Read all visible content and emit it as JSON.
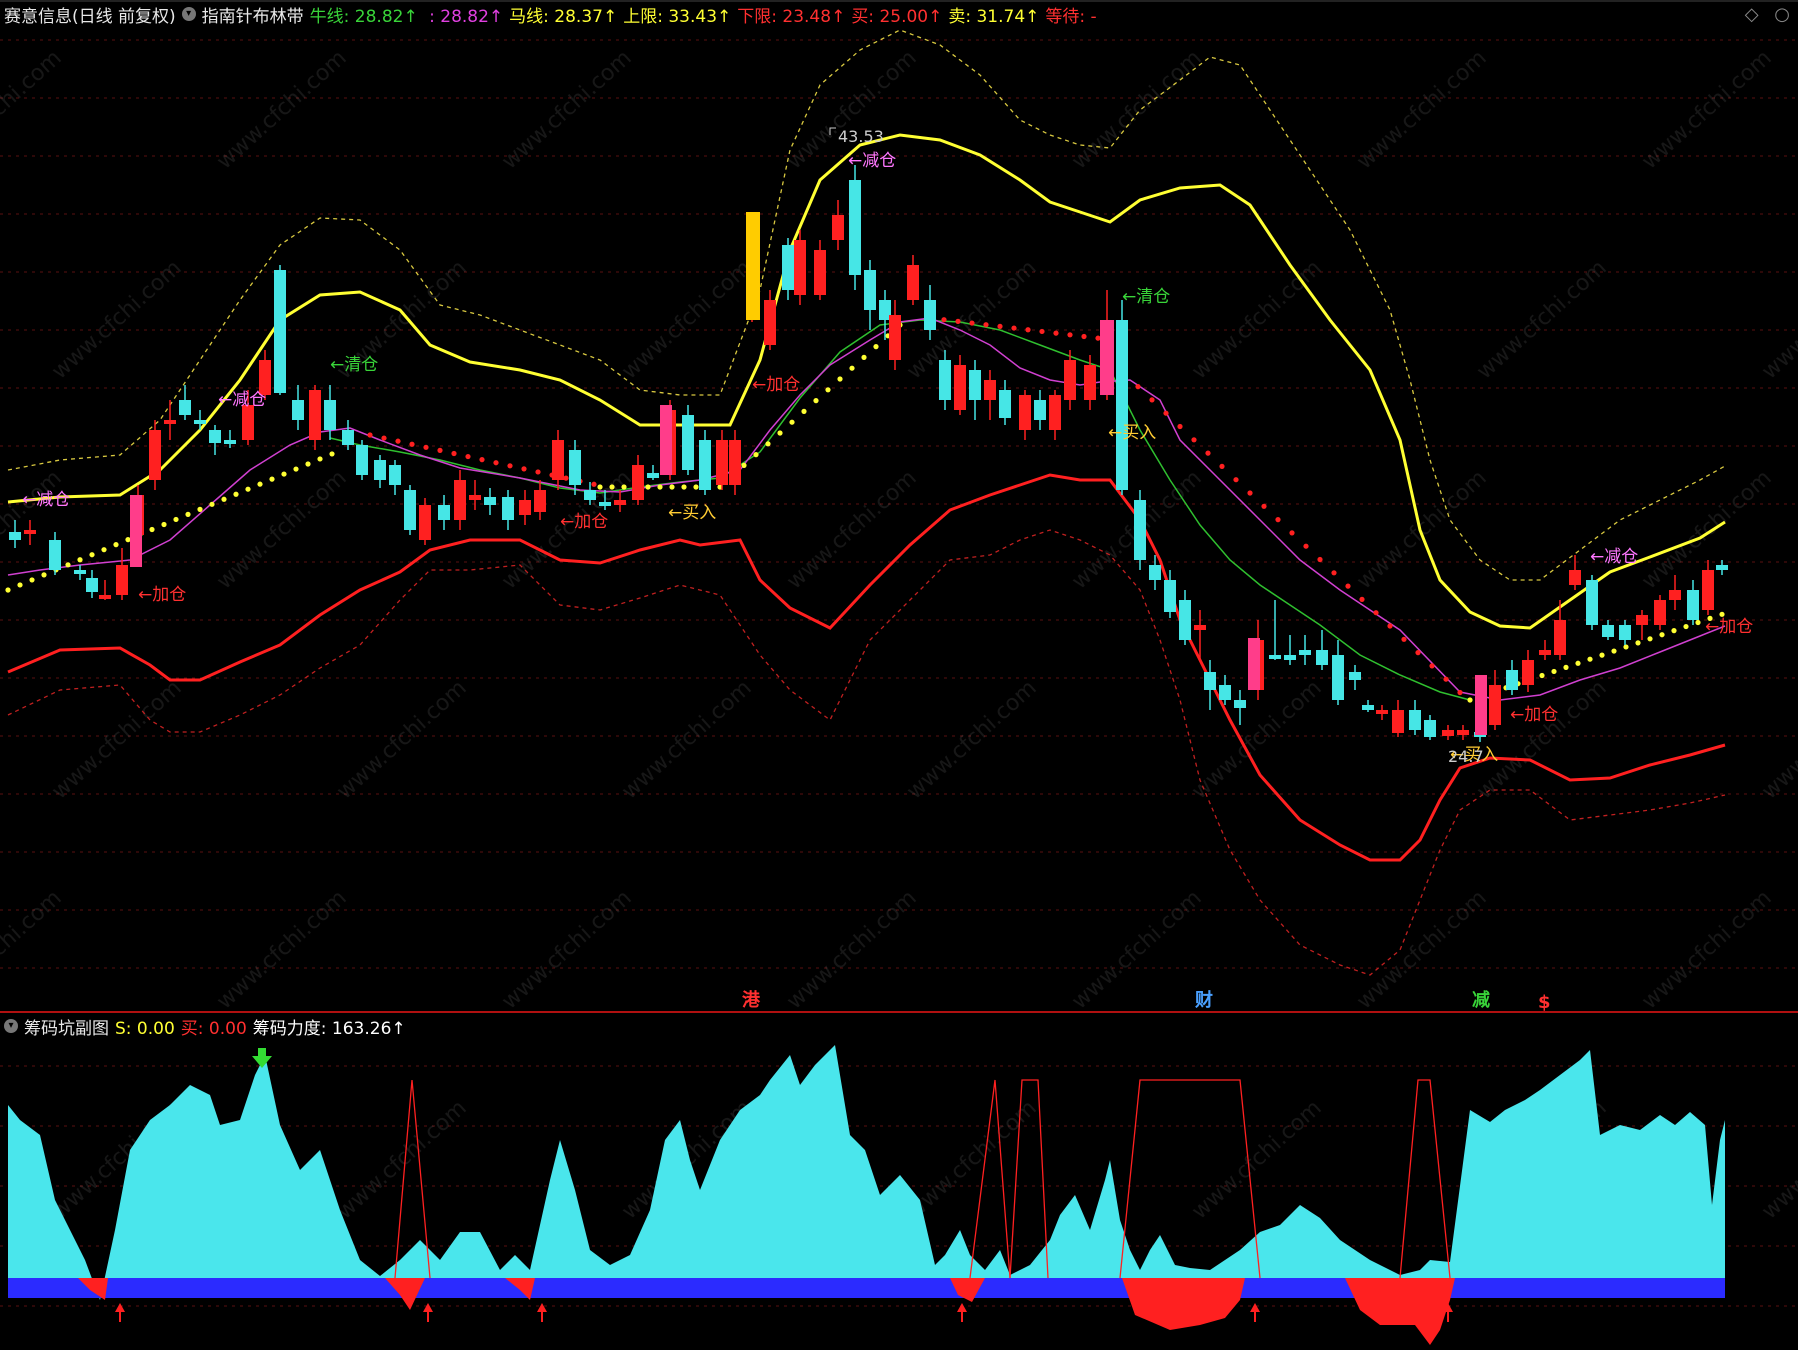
{
  "main_header": {
    "stock_name": "赛意信息(日线 前复权)",
    "indicator_name": "指南针布林带",
    "fields": [
      {
        "label": "牛线:",
        "value": "28.82",
        "arrow": "↑",
        "color": "#39d439"
      },
      {
        "label": "",
        "value": ": 28.82",
        "arrow": "↑",
        "color": "#e040e0"
      },
      {
        "label": "马线:",
        "value": "28.37",
        "arrow": "↑",
        "color": "#ffff33"
      },
      {
        "label": "上限:",
        "value": "33.43",
        "arrow": "↑",
        "color": "#ffff33"
      },
      {
        "label": "下限:",
        "value": "23.48",
        "arrow": "↑",
        "color": "#ff3030"
      },
      {
        "label": "买:",
        "value": "25.00",
        "arrow": "↑",
        "color": "#ff3030"
      },
      {
        "label": "卖:",
        "value": "31.74",
        "arrow": "↑",
        "color": "#ffff33"
      },
      {
        "label": "等待:",
        "value": "-",
        "arrow": "",
        "color": "#ff3030"
      }
    ]
  },
  "sub_header": {
    "indicator_name": "筹码坑副图",
    "fields": [
      {
        "label": "S:",
        "value": "0.00",
        "color": "#ffff33"
      },
      {
        "label": "买:",
        "value": "0.00",
        "color": "#ff3030"
      },
      {
        "label": "筹码力度:",
        "value": "163.26",
        "arrow": "↑",
        "color": "#ffffff"
      }
    ]
  },
  "corner_icons": [
    "diamond-icon",
    "ring-icon"
  ],
  "event_markers": [
    {
      "text": "港",
      "color": "#ff3030"
    },
    {
      "text": "财",
      "color": "#4aa0ff"
    },
    {
      "text": "减",
      "color": "#39d439"
    },
    {
      "text": "$",
      "color": "#ff3030"
    }
  ],
  "price_labels": [
    {
      "text": "43.53",
      "color": "#cccccc"
    },
    {
      "text": "24.7",
      "color": "#cccccc"
    }
  ],
  "signal_labels": [
    {
      "text": "←减仓",
      "color": "#ff77ff"
    },
    {
      "text": "←加仓",
      "color": "#ff3030"
    },
    {
      "text": "←减仓",
      "color": "#ff77ff"
    },
    {
      "text": "←清仓",
      "color": "#39d439"
    },
    {
      "text": "←加仓",
      "color": "#ff3030"
    },
    {
      "text": "←买入",
      "color": "#ffcc33"
    },
    {
      "text": "←加仓",
      "color": "#ff3030"
    },
    {
      "text": "←减仓",
      "color": "#ff77ff"
    },
    {
      "text": "←清仓",
      "color": "#39d439"
    },
    {
      "text": "←买入",
      "color": "#ffcc33"
    },
    {
      "text": "←加仓",
      "color": "#ff3030"
    },
    {
      "text": "←买入",
      "color": "#ffcc33"
    },
    {
      "text": "←减仓",
      "color": "#ff77ff"
    },
    {
      "text": "←加仓",
      "color": "#ff3030"
    }
  ],
  "watermark": "www.cfchi.com",
  "colors": {
    "background": "#000000",
    "up_candle": "#ff2020",
    "down_candle": "#46e6e6",
    "upper_band": "#ffff33",
    "lower_band": "#ff2020",
    "mid_line": "#2fbf2f",
    "ma_line": "#d040d0",
    "area_fill": "#4ae6ec",
    "pit_fill": "#ff2020",
    "base_bar": "#2b2bff",
    "grid": "#5a1010",
    "divider": "#b01010"
  }
}
